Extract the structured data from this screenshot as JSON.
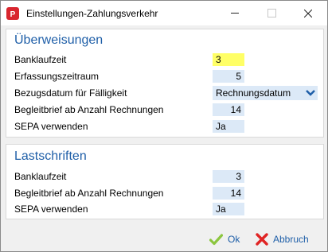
{
  "window": {
    "title": "Einstellungen-Zahlungsverkehr",
    "accent_color": "#1f5fa8",
    "field_bg_color": "#dce9f7",
    "highlight_color": "#ffff66"
  },
  "ueberweisungen": {
    "title": "Überweisungen",
    "banklaufzeit_label": "Banklaufzeit",
    "banklaufzeit_value": "3",
    "erfassungszeitraum_label": "Erfassungszeitraum",
    "erfassungszeitraum_value": "5",
    "bezugsdatum_label": "Bezugsdatum für Fälligkeit",
    "bezugsdatum_value": "Rechnungsdatum",
    "begleitbrief_label": "Begleitbrief ab Anzahl Rechnungen",
    "begleitbrief_value": "14",
    "sepa_label": "SEPA verwenden",
    "sepa_value": "Ja"
  },
  "lastschriften": {
    "title": "Lastschriften",
    "banklaufzeit_label": "Banklaufzeit",
    "banklaufzeit_value": "3",
    "begleitbrief_label": "Begleitbrief ab Anzahl Rechnungen",
    "begleitbrief_value": "14",
    "sepa_label": "SEPA verwenden",
    "sepa_value": "Ja"
  },
  "footer": {
    "ok_label": "Ok",
    "abbruch_label": "Abbruch",
    "ok_icon": "check-icon",
    "abbruch_icon": "cross-icon"
  }
}
